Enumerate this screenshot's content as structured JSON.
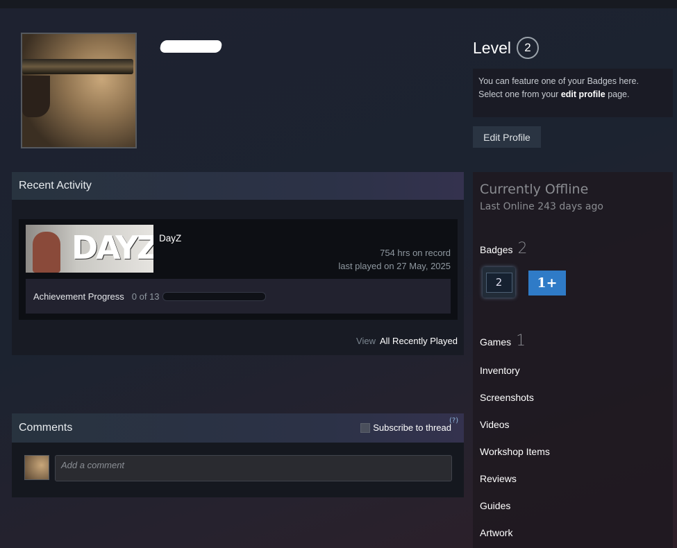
{
  "profile": {
    "level_label": "Level",
    "level": "2",
    "feature_text_1": "You can feature one of your Badges here.",
    "feature_text_2a": "Select one from your ",
    "feature_link": "edit profile",
    "feature_text_2b": " page.",
    "edit_profile": "Edit Profile"
  },
  "recent_activity": {
    "title": "Recent Activity",
    "game": {
      "name": "DayZ",
      "logo": "DAYZ",
      "hours": "754 hrs on record",
      "last_played": "last played on 27 May, 2025",
      "achievement_label": "Achievement Progress",
      "achievement_count": "0 of 13",
      "achievement_fraction": 0
    },
    "view_label": "View",
    "view_link": "All Recently Played"
  },
  "comments": {
    "title": "Comments",
    "subscribe": "Subscribe to thread",
    "help": "(?)",
    "placeholder": "Add a comment"
  },
  "sidebar": {
    "status": "Currently Offline",
    "last_online": "Last Online 243 days ago",
    "badges_label": "Badges",
    "badges_count": "2",
    "badge_items": [
      "2",
      "1+"
    ],
    "games_label": "Games",
    "games_count": "1",
    "links": [
      "Inventory",
      "Screenshots",
      "Videos",
      "Workshop Items",
      "Reviews",
      "Guides",
      "Artwork"
    ]
  }
}
